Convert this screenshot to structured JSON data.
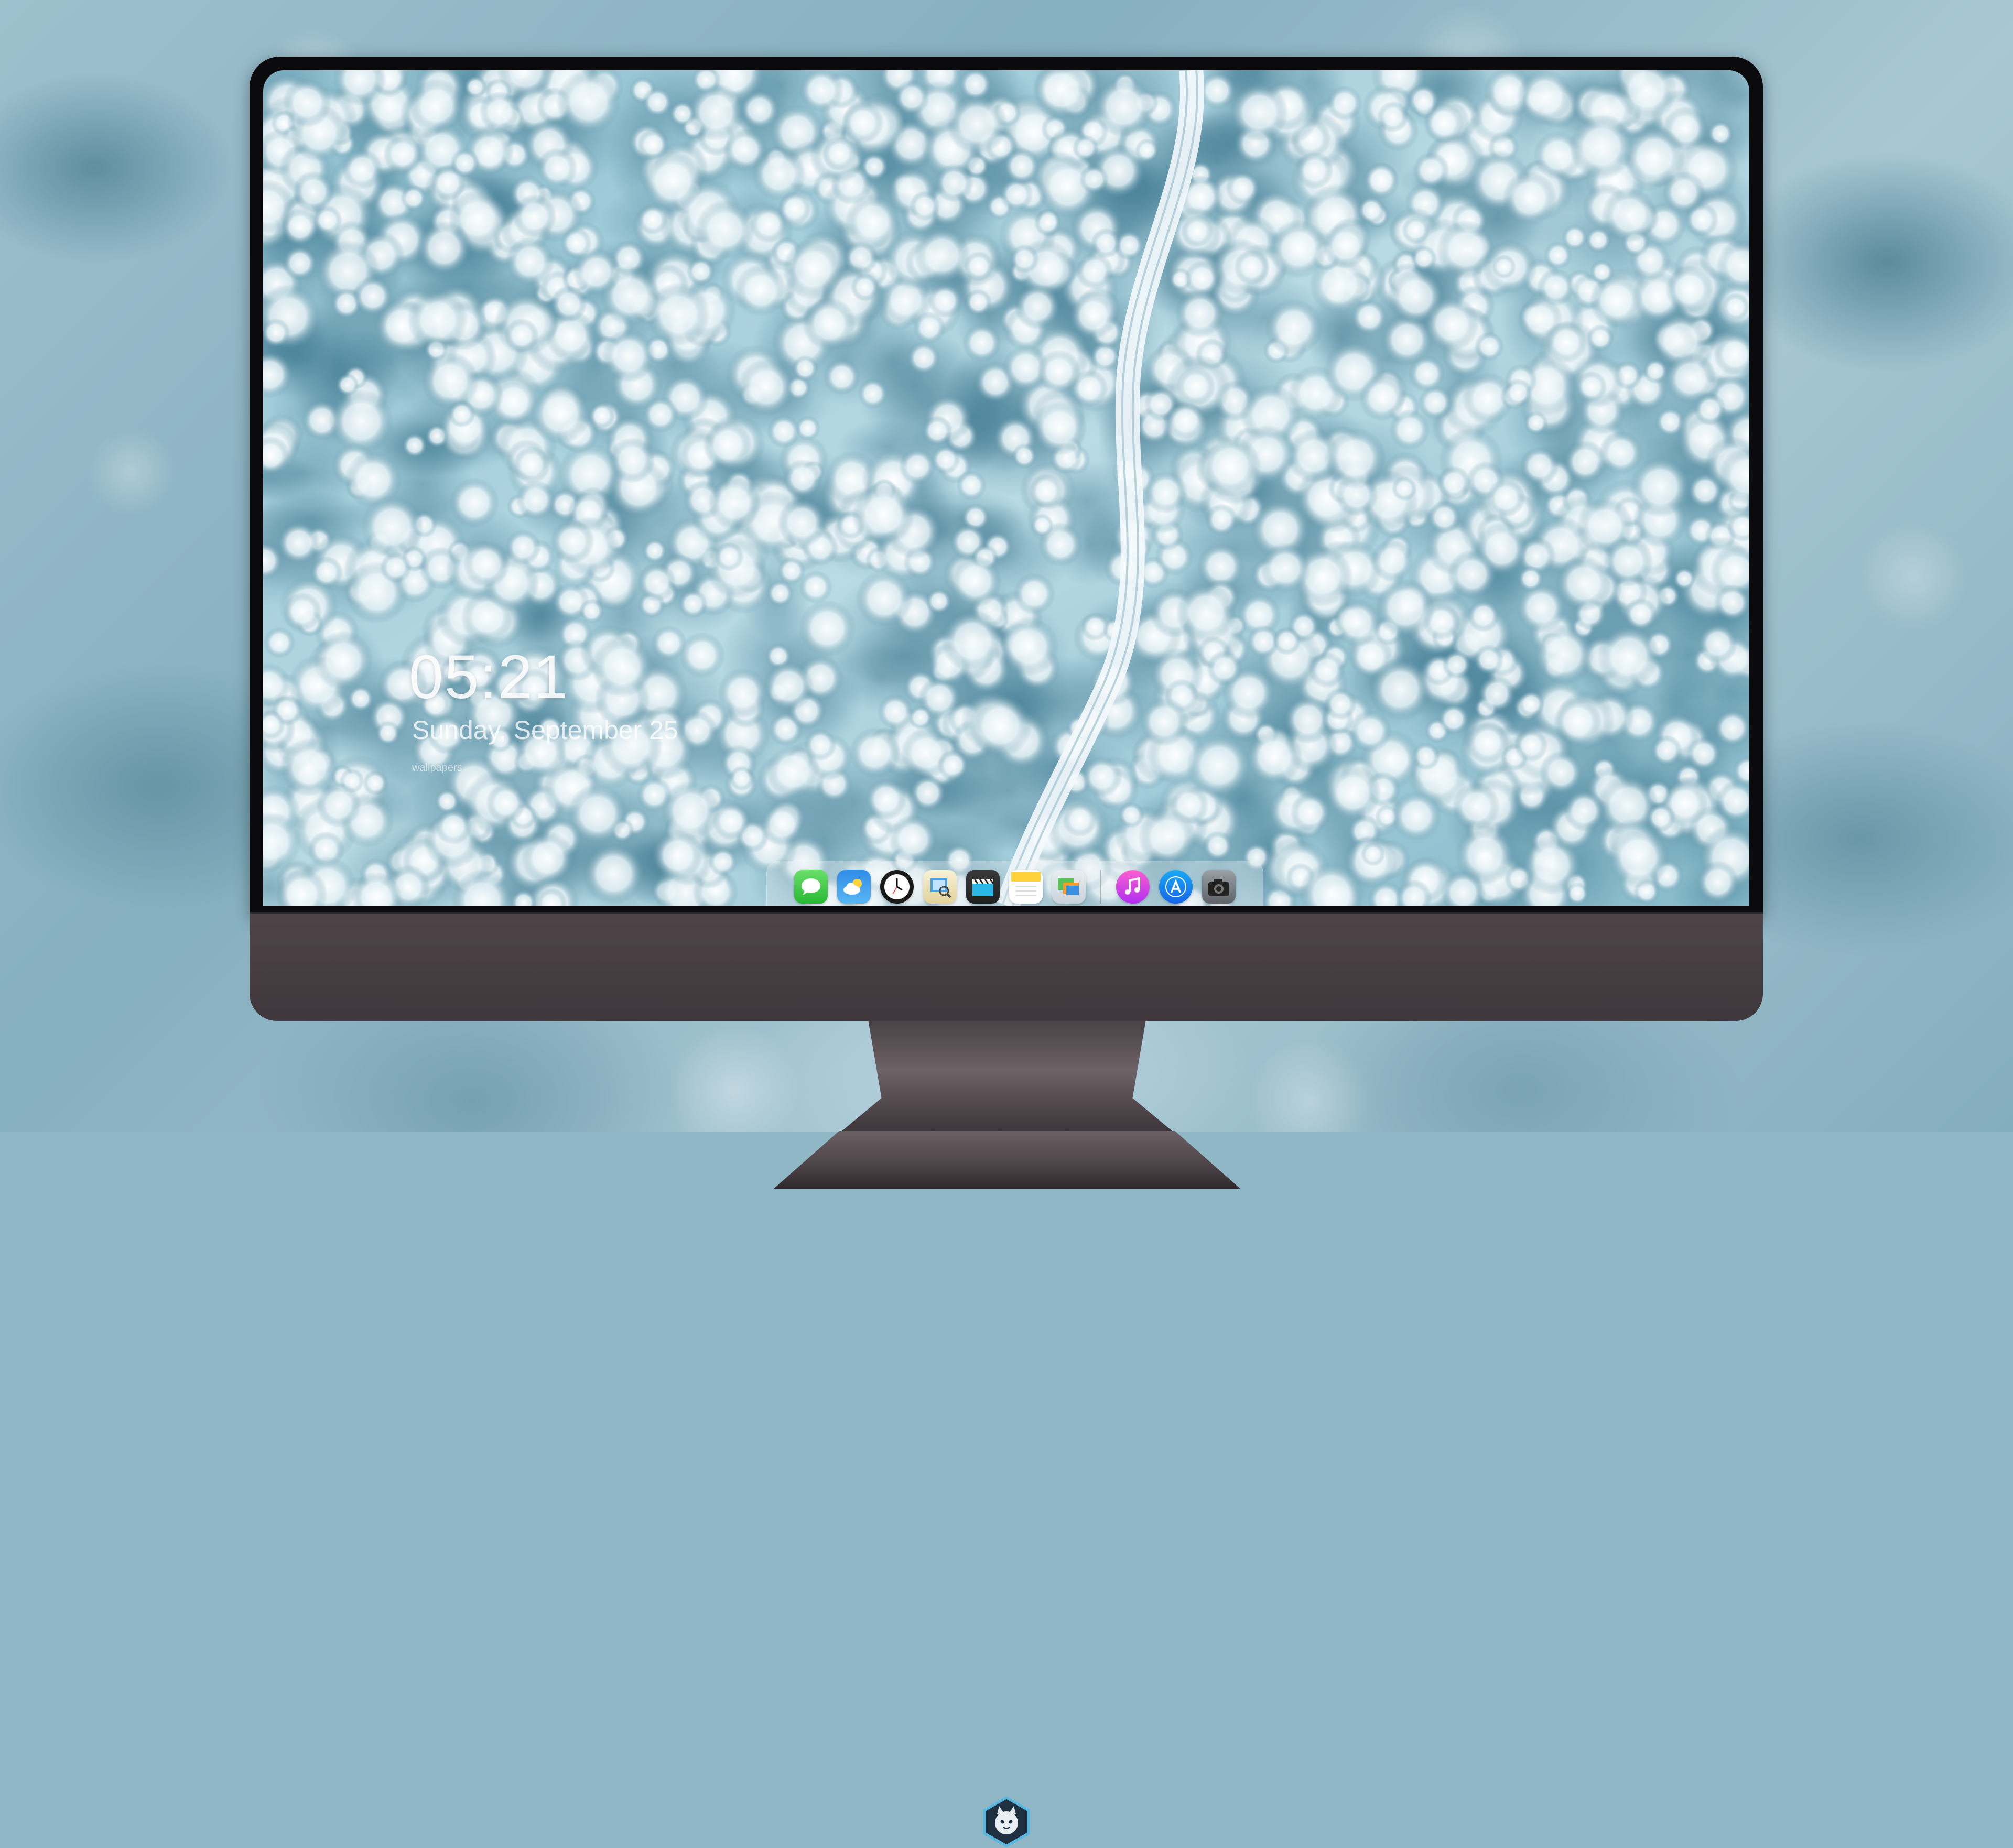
{
  "lockscreen": {
    "time": "05:21",
    "date": "Sunday, September 25",
    "caption": "wallpapers"
  },
  "dock": {
    "apps": [
      {
        "name": "Messages",
        "icon": "messages-icon"
      },
      {
        "name": "Weather",
        "icon": "weather-icon"
      },
      {
        "name": "Clock",
        "icon": "clock-icon"
      },
      {
        "name": "Preview",
        "icon": "preview-icon"
      },
      {
        "name": "Final Cut",
        "icon": "clapperboard-icon"
      },
      {
        "name": "Notes",
        "icon": "notes-icon"
      },
      {
        "name": "Photos",
        "icon": "photos-icon"
      },
      {
        "name": "iTunes",
        "icon": "music-icon"
      },
      {
        "name": "App Store",
        "icon": "app-store-icon"
      },
      {
        "name": "Camera",
        "icon": "camera-icon"
      }
    ]
  },
  "colors": {
    "background": "#8fb7c6",
    "bezel": "#0b0b0d",
    "chin": "#4f4549",
    "wallpaper": "#9fc8d4"
  }
}
